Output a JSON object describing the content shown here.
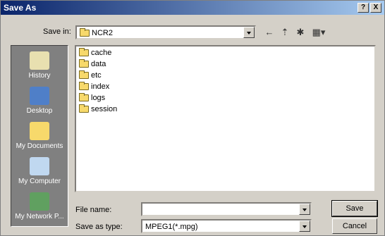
{
  "window": {
    "title": "Save As",
    "help_label": "?",
    "close_label": "X"
  },
  "save_in": {
    "label": "Save in:",
    "value": "NCR2"
  },
  "places": [
    {
      "label": "History",
      "icon": "history-icon"
    },
    {
      "label": "Desktop",
      "icon": "desktop-icon"
    },
    {
      "label": "My Documents",
      "icon": "my-documents-icon"
    },
    {
      "label": "My Computer",
      "icon": "my-computer-icon"
    },
    {
      "label": "My Network P...",
      "icon": "my-network-places-icon"
    }
  ],
  "files": [
    "cache",
    "data",
    "etc",
    "index",
    "logs",
    "session"
  ],
  "file_name": {
    "label": "File name:",
    "value": ""
  },
  "save_as_type": {
    "label": "Save as type:",
    "value": "MPEG1(*.mpg)"
  },
  "buttons": {
    "save": "Save",
    "cancel": "Cancel"
  },
  "toolbar": {
    "back": "←",
    "up": "⇡",
    "new_folder": "✱",
    "view": "▦▾"
  }
}
